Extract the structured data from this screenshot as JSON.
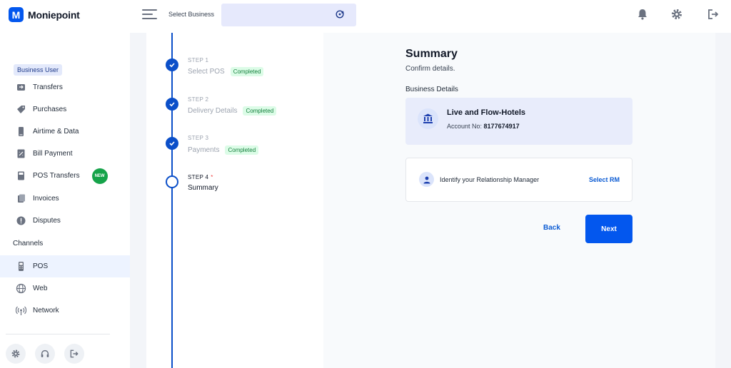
{
  "app": {
    "brand_letter": "M",
    "brand_name": "Moniepoint"
  },
  "topbar": {
    "select_business_label": "Select Business",
    "icons": [
      "menu-icon",
      "sync-icon",
      "bell-icon",
      "gear-icon",
      "logout-icon"
    ]
  },
  "sidebar": {
    "role_badge": "Business User",
    "items": [
      {
        "label": "Transfers",
        "icon": "transfer-icon"
      },
      {
        "label": "Purchases",
        "icon": "tag-icon"
      },
      {
        "label": "Airtime & Data",
        "icon": "phone-icon"
      },
      {
        "label": "Bill Payment",
        "icon": "bill-icon"
      },
      {
        "label": "POS Transfers",
        "icon": "pos-transfer-icon",
        "badge": "NEW"
      },
      {
        "label": "Invoices",
        "icon": "invoice-icon"
      },
      {
        "label": "Disputes",
        "icon": "alert-icon"
      }
    ],
    "section_channels": "Channels",
    "channels": [
      {
        "label": "POS",
        "icon": "pos-icon",
        "active": true
      },
      {
        "label": "Web",
        "icon": "globe-icon"
      },
      {
        "label": "Network",
        "icon": "network-icon"
      }
    ]
  },
  "stepper": {
    "steps": [
      {
        "num": "STEP 1",
        "title": "Select POS",
        "status": "Completed"
      },
      {
        "num": "STEP 2",
        "title": "Delivery Details",
        "status": "Completed"
      },
      {
        "num": "STEP 3",
        "title": "Payments",
        "status": "Completed"
      },
      {
        "num": "STEP 4",
        "title": "Summary",
        "required_mark": "*"
      }
    ]
  },
  "summary": {
    "title": "Summary",
    "subtitle": "Confirm details.",
    "section": "Business Details",
    "business_name": "Live and Flow-Hotels",
    "account_label": "Account No:",
    "account_number": "8177674917",
    "rm_prompt": "Identify your Relationship Manager",
    "rm_action": "Select RM",
    "back_label": "Back",
    "next_label": "Next"
  },
  "colors": {
    "primary": "#0357ee",
    "success": "#16a34a",
    "accent_bg": "#e8ecfb"
  }
}
